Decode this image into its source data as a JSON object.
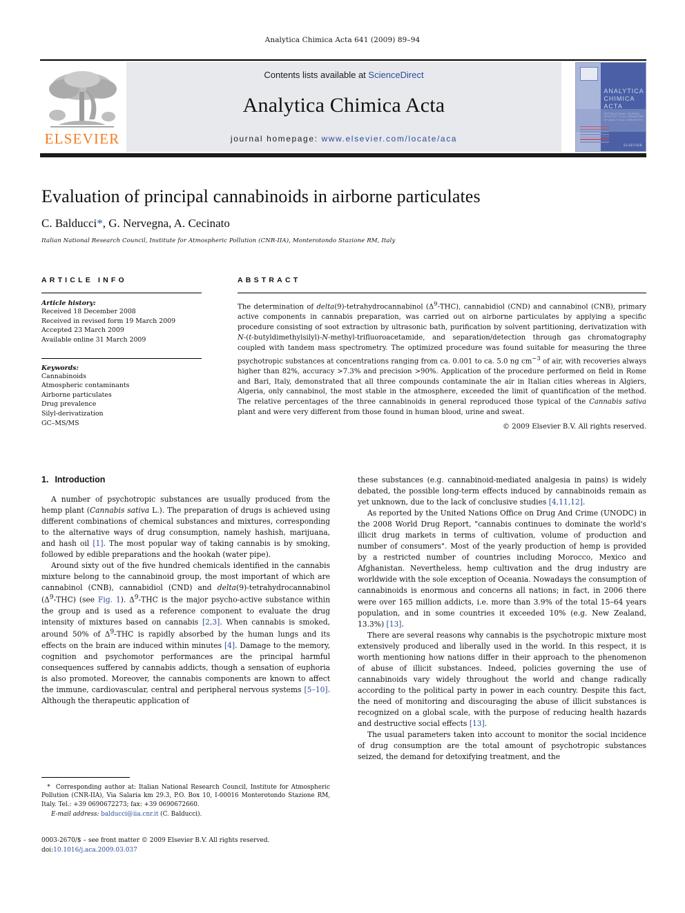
{
  "running_head": "Analytica Chimica Acta 641 (2009) 89–94",
  "masthead": {
    "contents_prefix": "Contents lists available at ",
    "contents_link": "ScienceDirect",
    "journal_title": "Analytica Chimica Acta",
    "homepage_prefix": "journal homepage:",
    "homepage_url": "www.elsevier.com/locate/aca",
    "publisher_logo_word": "ELSEVIER",
    "cover": {
      "title_line1": "ANALYTICA",
      "title_line2": "CHIMICA ACTA",
      "subtitle": "INTERNATIONAL JOURNAL DEVOTED TO ALL BRANCHES OF ANALYTICAL CHEMISTRY",
      "publisher": "ELSEVIER"
    },
    "link_color": "#2b4b9b",
    "logo_color": "#f47c20",
    "panel_color": "#e8e9ed"
  },
  "article": {
    "title": "Evaluation of principal cannabinoids in airborne particulates",
    "authors": "C. Balducci",
    "authors_rest": ", G. Nervegna, A. Cecinato",
    "corresponding_mark": "*",
    "affiliation": "Italian National Research Council, Institute for Atmospheric Pollution (CNR-IIA), Monterotondo Stazione RM, Italy"
  },
  "article_info": {
    "heading": "ARTICLE INFO",
    "history_label": "Article history:",
    "history": [
      "Received 18 December 2008",
      "Received in revised form 19 March 2009",
      "Accepted 23 March 2009",
      "Available online 31 March 2009"
    ],
    "keywords_label": "Keywords:",
    "keywords": [
      "Cannabinoids",
      "Atmospheric contaminants",
      "Airborne particulates",
      "Drug prevalence",
      "Silyl-derivatization",
      "GC–MS/MS"
    ]
  },
  "abstract": {
    "heading": "ABSTRACT",
    "p1_a": "The determination of ",
    "p1_delta": "delta",
    "p1_b": "(9)-tetrahydrocannabinol (Δ",
    "p1_sup": "9",
    "p1_c": "-THC), cannabidiol (CND) and cannabinol (CNB), primary active components in cannabis preparation, was carried out on airborne particulates by applying a specific procedure consisting of soot extraction by ultrasonic bath, purification by solvent partitioning, derivatization with ",
    "p1_n1": "N",
    "p1_d": "-(",
    "p1_t": "t",
    "p1_e": "-butyldimethylsilyl)-",
    "p1_n2": "N",
    "p1_f": "-methyl-trifluoroacetamide, and separation/detection through gas chromatography coupled with tandem mass spectrometry. The optimized procedure was found suitable for measuring the three psychotropic substances at concentrations ranging from ca. 0.001 to ca. 5.0 ng cm",
    "p1_sup2": "−3",
    "p1_g": " of air, with recoveries always higher than 82%, accuracy >7.3% and precision >90%. Application of the procedure performed on field in Rome and Bari, Italy, demonstrated that all three compounds contaminate the air in Italian cities whereas in Algiers, Algeria, only cannabinol, the most stable in the atmosphere, exceeded the limit of quantification of the method. The relative percentages of the three cannabinoids in general reproduced those typical of the ",
    "p1_cannabis": "Cannabis sativa",
    "p1_h": " plant and were very different from those found in human blood, urine and sweat.",
    "copyright": "© 2009 Elsevier B.V. All rights reserved."
  },
  "body": {
    "section_number": "1.",
    "section_title": "Introduction",
    "left": {
      "para1_a": "A number of psychotropic substances are usually produced from the hemp plant (",
      "para1_it": "Cannabis sativa",
      "para1_b": " L.). The preparation of drugs is achieved using different combinations of chemical substances and mixtures, corresponding to the alternative ways of drug consumption, namely hashish, marijuana, and hash oil ",
      "para1_ref1": "[1]",
      "para1_c": ". The most popular way of taking cannabis is by smoking, followed by edible preparations and the hookah (water pipe).",
      "para2_a": "Around sixty out of the five hundred chemicals identified in the cannabis mixture belong to the cannabinoid group, the most important of which are cannabinol (CNB), cannabidiol (CND) and ",
      "para2_it": "delta",
      "para2_b": "(9)-tetrahydrocannabinol (Δ",
      "para2_sup": "9",
      "para2_c": "-THC) (see ",
      "para2_fig": "Fig. 1",
      "para2_d": "). Δ",
      "para2_sup2": "9",
      "para2_e": "-THC is the major psycho-active substance within the group and is used as a reference component to evaluate the drug intensity of mixtures based on cannabis ",
      "para2_ref": "[2,3]",
      "para2_f": ". When cannabis is smoked, around 50% of Δ",
      "para2_sup3": "9",
      "para2_g": "-THC is rapidly absorbed by the human lungs and its effects on the brain are induced within minutes ",
      "para2_ref2": "[4]",
      "para2_h": ". Damage to the memory, cognition and psychomotor performances are the principal harmful consequences suffered by cannabis addicts, though a sensation of euphoria is also promoted. Moreover, the cannabis components are known to affect the immune, cardiovascular, central and peripheral nervous systems ",
      "para2_ref3": "[5–10]",
      "para2_i": ". Although the therapeutic application of"
    },
    "right": {
      "para3_a": "these substances (e.g. cannabinoid-mediated analgesia in pains) is widely debated, the possible long-term effects induced by cannabinoids remain as yet unknown, due to the lack of conclusive studies ",
      "para3_ref": "[4,11,12]",
      "para3_b": ".",
      "para4_a": "As reported by the United Nations Office on Drug And Crime (UNODC) in the 2008 World Drug Report, \"cannabis continues to dominate the world's illicit drug markets in terms of cultivation, volume of production and number of consumers\". Most of the yearly production of hemp is provided by a restricted number of countries including Morocco, Mexico and Afghanistan. Nevertheless, hemp cultivation and the drug industry are worldwide with the sole exception of Oceania. Nowadays the consumption of cannabinoids is enormous and concerns all nations; in fact, in 2006 there were over 165 million addicts, i.e. more than 3.9% of the total 15–64 years population, and in some countries it exceeded 10% (e.g. New Zealand, 13.3%) ",
      "para4_ref": "[13]",
      "para4_b": ".",
      "para5_a": "There are several reasons why cannabis is the psychotropic mixture most extensively produced and liberally used in the world. In this respect, it is worth mentioning how nations differ in their approach to the phenomenon of abuse of illicit substances. Indeed, policies governing the use of cannabinoids vary widely throughout the world and change radically according to the political party in power in each country. Despite this fact, the need of monitoring and discouraging the abuse of illicit substances is recognized on a global scale, with the purpose of reducing health hazards and destructive social effects ",
      "para5_ref": "[13]",
      "para5_b": ".",
      "para6": "The usual parameters taken into account to monitor the social incidence of drug consumption are the total amount of psychotropic substances seized, the demand for detoxifying treatment, and the"
    }
  },
  "footnote": {
    "mark": "*",
    "text": "Corresponding author at: Italian National Research Council, Institute for Atmospheric Pollution (CNR-IIA), Via Salaria km 29.3, P.O. Box 10, I-00016 Monterotondo Stazione RM, Italy. Tel.: +39 0690672273; fax: +39 0690672660.",
    "email_label": "E-mail address:",
    "email": "balducci@iia.cnr.it",
    "email_owner": "(C. Balducci)."
  },
  "imprint": {
    "line1": "0003-2670/$ – see front matter © 2009 Elsevier B.V. All rights reserved.",
    "doi_label": "doi:",
    "doi": "10.1016/j.aca.2009.03.037"
  }
}
